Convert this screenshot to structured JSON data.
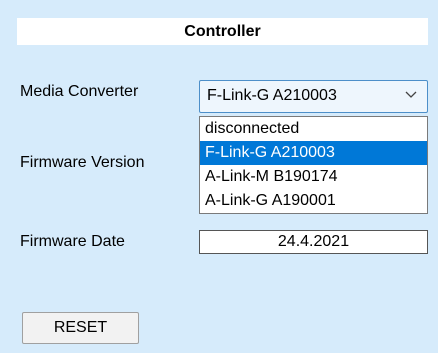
{
  "header": {
    "title": "Controller"
  },
  "labels": {
    "media_converter": "Media Converter",
    "firmware_version": "Firmware Version",
    "firmware_date": "Firmware Date"
  },
  "media_converter": {
    "selected": "F-Link-G A210003",
    "options": [
      "disconnected",
      "F-Link-G A210003",
      "A-Link-M B190174",
      "A-Link-G A190001"
    ],
    "highlighted_index": 1
  },
  "firmware_date": {
    "value": "24.4.2021"
  },
  "buttons": {
    "reset": "RESET"
  },
  "colors": {
    "background": "#d6ebfb",
    "selection": "#0078d7",
    "combo_border": "#4d8fc9"
  }
}
